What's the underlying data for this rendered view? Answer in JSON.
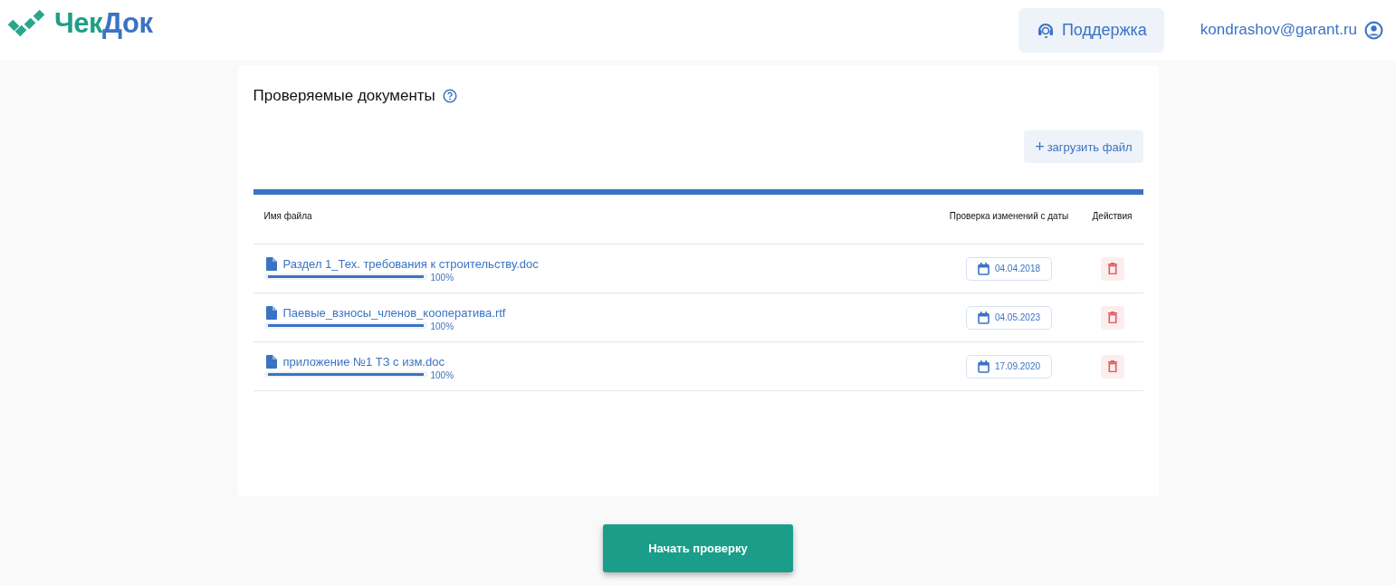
{
  "header": {
    "logo": {
      "part_1": "Чек",
      "part_2": "Док"
    },
    "support_button": "Поддержка",
    "user_email": "kondrashov@garant.ru"
  },
  "documents": {
    "title": "Проверяемые документы",
    "upload_button": "загрузить файл",
    "upload_icon": "+",
    "table": {
      "columns": [
        "Имя файла",
        "Проверка изменений с даты",
        "Действия"
      ],
      "rows": [
        {
          "file_name": "Раздел 1_Тех. требования к строительству.doc",
          "progress": {
            "level": 1.0,
            "reading": "100%"
          },
          "date": "04.04.2018"
        },
        {
          "file_name": "Паевые_взносы_членов_кооператива.rtf",
          "progress": {
            "level": 1.0,
            "reading": "100%"
          },
          "date": "04.05.2023"
        },
        {
          "file_name": "приложение №1 ТЗ с изм.doc",
          "progress": {
            "level": 1.0,
            "reading": "100%"
          },
          "date": "17.09.2020"
        }
      ]
    }
  },
  "start_button": "Начать проверку"
}
